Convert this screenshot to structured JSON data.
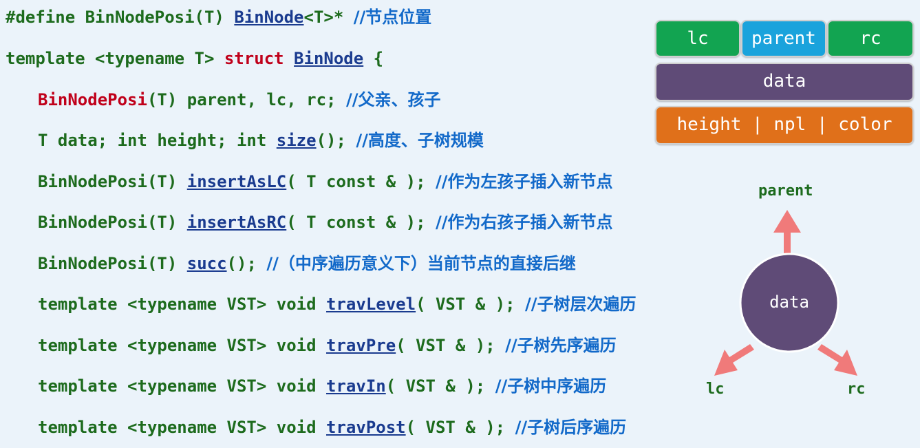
{
  "code_lines": [
    {
      "indent": 0,
      "segments": [
        {
          "text": "#define BinNodePosi(T) ",
          "style": "plain"
        },
        {
          "text": "BinNode",
          "style": "link"
        },
        {
          "text": "<T>* ",
          "style": "plain"
        },
        {
          "text": "//节点位置",
          "style": "comment"
        }
      ]
    },
    {
      "indent": 0,
      "segments": [
        {
          "text": "template <typename T> ",
          "style": "plain"
        },
        {
          "text": "struct",
          "style": "red"
        },
        {
          "text": " ",
          "style": "plain"
        },
        {
          "text": "BinNode",
          "style": "link"
        },
        {
          "text": " {",
          "style": "plain"
        }
      ]
    },
    {
      "indent": 1,
      "segments": [
        {
          "text": "BinNodePosi",
          "style": "red"
        },
        {
          "text": "(T) parent, lc, rc; ",
          "style": "plain"
        },
        {
          "text": "//父亲、孩子",
          "style": "comment"
        }
      ]
    },
    {
      "indent": 1,
      "segments": [
        {
          "text": "T data; int height; int ",
          "style": "plain"
        },
        {
          "text": "size",
          "style": "link"
        },
        {
          "text": "(); ",
          "style": "plain"
        },
        {
          "text": "//高度、子树规模",
          "style": "comment"
        }
      ]
    },
    {
      "indent": 1,
      "segments": [
        {
          "text": "BinNodePosi(T) ",
          "style": "plain"
        },
        {
          "text": "insertAsLC",
          "style": "link"
        },
        {
          "text": "( T const & ); ",
          "style": "plain"
        },
        {
          "text": "//作为左孩子插入新节点",
          "style": "comment"
        }
      ]
    },
    {
      "indent": 1,
      "segments": [
        {
          "text": "BinNodePosi(T) ",
          "style": "plain"
        },
        {
          "text": "insertAsRC",
          "style": "link"
        },
        {
          "text": "( T const & ); ",
          "style": "plain"
        },
        {
          "text": "//作为右孩子插入新节点",
          "style": "comment"
        }
      ]
    },
    {
      "indent": 1,
      "segments": [
        {
          "text": "BinNodePosi(T) ",
          "style": "plain"
        },
        {
          "text": "succ",
          "style": "link"
        },
        {
          "text": "(); ",
          "style": "plain"
        },
        {
          "text": "//（中序遍历意义下）当前节点的直接后继",
          "style": "comment"
        }
      ]
    },
    {
      "indent": 1,
      "segments": [
        {
          "text": "template <typename VST> void ",
          "style": "plain"
        },
        {
          "text": "travLevel",
          "style": "link"
        },
        {
          "text": "( VST & ); ",
          "style": "plain"
        },
        {
          "text": "//子树层次遍历",
          "style": "comment"
        }
      ]
    },
    {
      "indent": 1,
      "segments": [
        {
          "text": "template <typename VST> void ",
          "style": "plain"
        },
        {
          "text": "travPre",
          "style": "link"
        },
        {
          "text": "( VST & ); ",
          "style": "plain"
        },
        {
          "text": "//子树先序遍历",
          "style": "comment"
        }
      ]
    },
    {
      "indent": 1,
      "segments": [
        {
          "text": "template <typename VST> void ",
          "style": "plain"
        },
        {
          "text": "travIn",
          "style": "link"
        },
        {
          "text": "( VST & ); ",
          "style": "plain"
        },
        {
          "text": "//子树中序遍历",
          "style": "comment"
        }
      ]
    },
    {
      "indent": 1,
      "segments": [
        {
          "text": "template <typename VST> void ",
          "style": "plain"
        },
        {
          "text": "travPost",
          "style": "link"
        },
        {
          "text": "( VST & ); ",
          "style": "plain"
        },
        {
          "text": "//子树后序遍历",
          "style": "comment"
        }
      ]
    }
  ],
  "node_layout": {
    "row1": [
      "lc",
      "parent",
      "rc"
    ],
    "row2": "data",
    "row3": "height | npl | color"
  },
  "node_diagram": {
    "center_label": "data",
    "parent_label": "parent",
    "lc_label": "lc",
    "rc_label": "rc"
  },
  "colors": {
    "background": "#ebf3fa",
    "code_green": "#1d6b1d",
    "keyword_red": "#c0001a",
    "link_navy": "#1a3b8f",
    "comment_blue": "#1269c9",
    "cell_green": "#12a451",
    "cell_blue": "#1aa3dc",
    "cell_purple": "#5f4b77",
    "cell_orange": "#e0701a",
    "arrow_pink": "#f07a7a",
    "circle_purple": "#5f4b77"
  }
}
